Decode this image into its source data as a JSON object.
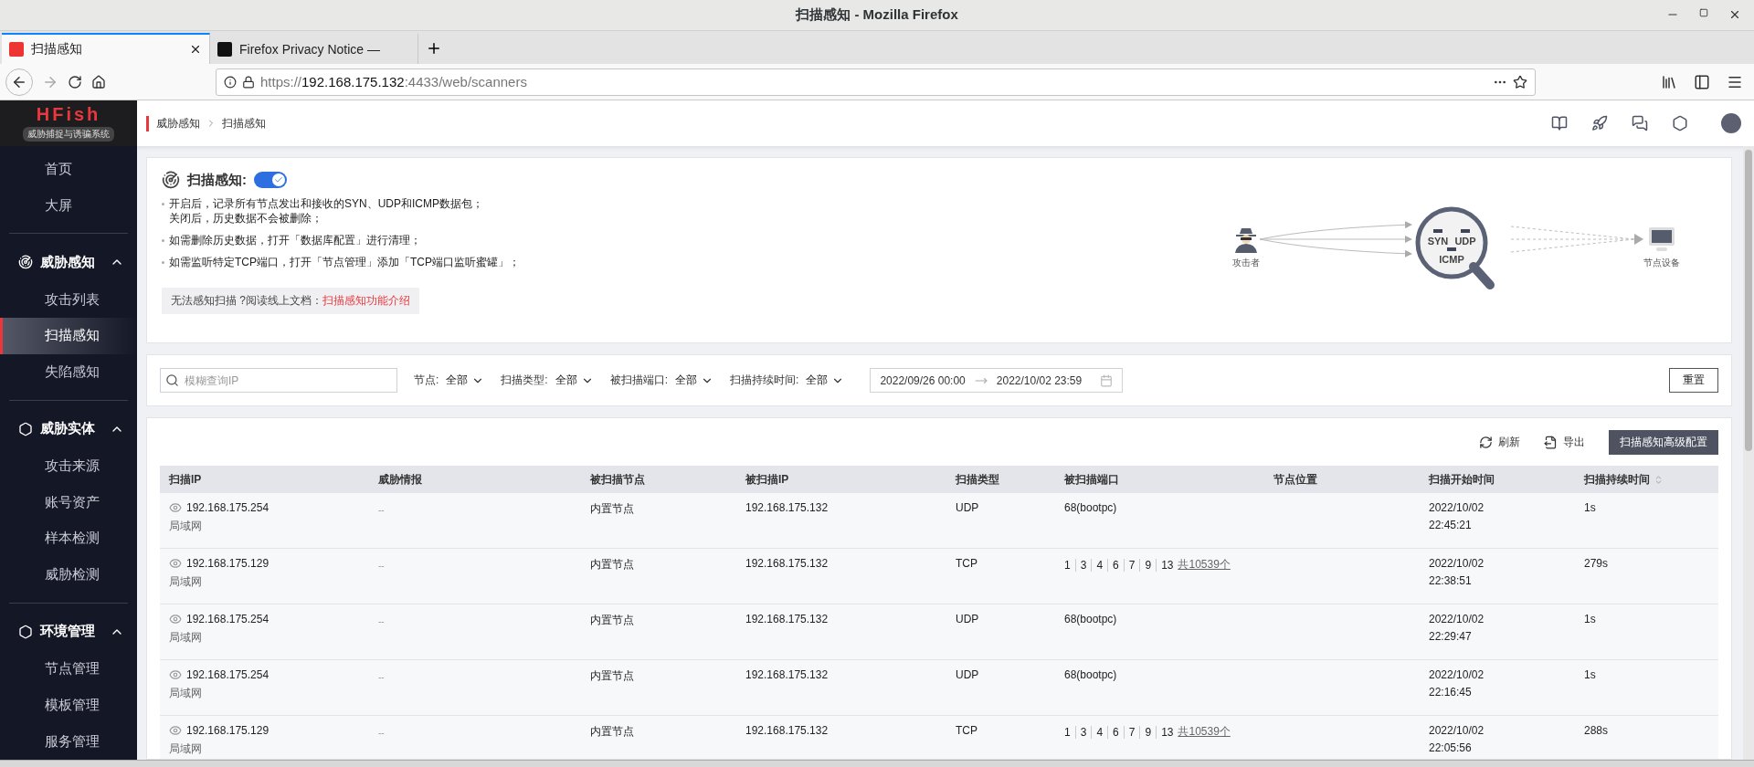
{
  "window": {
    "title": "扫描感知 - Mozilla Firefox"
  },
  "browser_tabs": [
    {
      "label": "扫描感知",
      "selected": true
    },
    {
      "label": "Firefox Privacy Notice —",
      "selected": false
    }
  ],
  "address_bar": {
    "scheme": "https://",
    "host": "192.168.175.132",
    "path": ":4433/web/scanners"
  },
  "sidebar": {
    "logo": "HFish",
    "subtitle": "威胁捕捉与诱骗系统",
    "items": [
      {
        "kind": "link",
        "label": "首页",
        "selected": false
      },
      {
        "kind": "link",
        "label": "大屏",
        "selected": false
      },
      {
        "kind": "group",
        "label": "威胁感知",
        "expanded": true,
        "children": [
          {
            "label": "攻击列表",
            "selected": false
          },
          {
            "label": "扫描感知",
            "selected": true
          },
          {
            "label": "失陷感知",
            "selected": false
          }
        ]
      },
      {
        "kind": "group",
        "label": "威胁实体",
        "expanded": true,
        "children": [
          {
            "label": "攻击来源",
            "selected": false
          },
          {
            "label": "账号资产",
            "selected": false
          },
          {
            "label": "样本检测",
            "selected": false
          },
          {
            "label": "威胁检测",
            "selected": false
          }
        ]
      },
      {
        "kind": "group",
        "label": "环境管理",
        "expanded": true,
        "children": [
          {
            "label": "节点管理",
            "selected": false
          },
          {
            "label": "模板管理",
            "selected": false
          },
          {
            "label": "服务管理",
            "selected": false
          }
        ]
      }
    ]
  },
  "breadcrumb": [
    "威胁感知",
    "扫描感知"
  ],
  "info": {
    "title": "扫描感知:",
    "enabled": true,
    "bullets": [
      [
        "开启后，记录所有节点发出和接收的SYN、UDP和ICMP数据包；",
        "关闭后，历史数据不会被删除；"
      ],
      [
        "如需删除历史数据，打开「数据库配置」进行清理；"
      ],
      [
        "如需监听特定TCP端口，打开「节点管理」添加「TCP端口监听蜜罐」；"
      ]
    ],
    "note": "无法感知扫描 ?阅读线上文档：",
    "note_link": "扫描感知功能介绍",
    "diagram": {
      "attacker": "攻击者",
      "protocols": [
        "SYN",
        "UDP",
        "ICMP"
      ],
      "target": "节点设备"
    }
  },
  "filters": {
    "search": {
      "placeholder": "模糊查询IP"
    },
    "dropdowns": [
      {
        "label": "节点:",
        "value": "全部"
      },
      {
        "label": "扫描类型:",
        "value": "全部"
      },
      {
        "label": "被扫描端口:",
        "value": "全部"
      },
      {
        "label": "扫描持续时间:",
        "value": "全部"
      }
    ],
    "date_from": "2022/09/26 00:00",
    "date_to": "2022/10/02 23:59",
    "reset": "重置"
  },
  "toolbar": {
    "refresh": "刷新",
    "export": "导出",
    "config": "扫描感知高级配置"
  },
  "table": {
    "columns": [
      {
        "label": "扫描IP",
        "sortable": false
      },
      {
        "label": "威胁情报",
        "sortable": false
      },
      {
        "label": "被扫描节点",
        "sortable": false
      },
      {
        "label": "被扫描IP",
        "sortable": false
      },
      {
        "label": "扫描类型",
        "sortable": false
      },
      {
        "label": "被扫描端口",
        "sortable": false
      },
      {
        "label": "节点位置",
        "sortable": false
      },
      {
        "label": "扫描开始时间",
        "sortable": false
      },
      {
        "label": "扫描持续时间",
        "sortable": true
      }
    ],
    "rows": [
      {
        "ip": "192.168.175.254",
        "network": "局域网",
        "intel": "--",
        "node": "内置节点",
        "target_ip": "192.168.175.132",
        "type": "UDP",
        "port": {
          "kind": "text",
          "text": "68(bootpc)"
        },
        "start_date": "2022/10/02",
        "start_time": "22:45:21",
        "duration": "1s"
      },
      {
        "ip": "192.168.175.129",
        "network": "局域网",
        "intel": "--",
        "node": "内置节点",
        "target_ip": "192.168.175.132",
        "type": "TCP",
        "port": {
          "kind": "list",
          "items": [
            "1",
            "3",
            "4",
            "6",
            "7",
            "9",
            "13"
          ],
          "total": "共10539个"
        },
        "start_date": "2022/10/02",
        "start_time": "22:38:51",
        "duration": "279s"
      },
      {
        "ip": "192.168.175.254",
        "network": "局域网",
        "intel": "--",
        "node": "内置节点",
        "target_ip": "192.168.175.132",
        "type": "UDP",
        "port": {
          "kind": "text",
          "text": "68(bootpc)"
        },
        "start_date": "2022/10/02",
        "start_time": "22:29:47",
        "duration": "1s"
      },
      {
        "ip": "192.168.175.254",
        "network": "局域网",
        "intel": "--",
        "node": "内置节点",
        "target_ip": "192.168.175.132",
        "type": "UDP",
        "port": {
          "kind": "text",
          "text": "68(bootpc)"
        },
        "start_date": "2022/10/02",
        "start_time": "22:16:45",
        "duration": "1s"
      },
      {
        "ip": "192.168.175.129",
        "network": "局域网",
        "intel": "--",
        "node": "内置节点",
        "target_ip": "192.168.175.132",
        "type": "TCP",
        "port": {
          "kind": "list",
          "items": [
            "1",
            "3",
            "4",
            "6",
            "7",
            "9",
            "13"
          ],
          "total": "共10539个"
        },
        "start_date": "2022/10/02",
        "start_time": "22:05:56",
        "duration": "288s"
      }
    ]
  }
}
